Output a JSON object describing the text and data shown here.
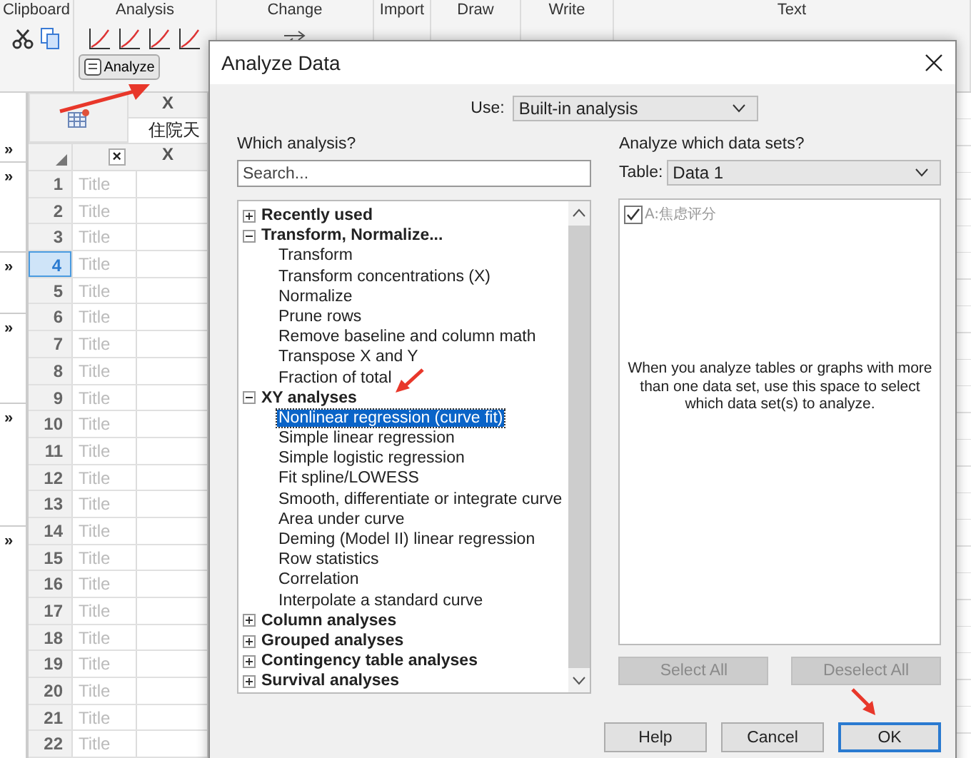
{
  "ribbon": {
    "groups": [
      {
        "label": "Clipboard"
      },
      {
        "label": "Analysis",
        "button": "Analyze"
      },
      {
        "label": "Change"
      },
      {
        "label": "Import"
      },
      {
        "label": "Draw"
      },
      {
        "label": "Write"
      },
      {
        "label": "Text"
      }
    ]
  },
  "sidebar": {
    "toggles": [
      "»",
      "»",
      "»",
      "»",
      "»",
      "»"
    ]
  },
  "sheet": {
    "header_top": "X",
    "header_sub": "住院天",
    "header_col": "X",
    "close_mark": "×",
    "rows": [
      {
        "number": "1",
        "title": "Title",
        "selected": false
      },
      {
        "number": "2",
        "title": "Title",
        "selected": false
      },
      {
        "number": "3",
        "title": "Title",
        "selected": false
      },
      {
        "number": "4",
        "title": "Title",
        "selected": true
      },
      {
        "number": "5",
        "title": "Title",
        "selected": false
      },
      {
        "number": "6",
        "title": "Title",
        "selected": false
      },
      {
        "number": "7",
        "title": "Title",
        "selected": false
      },
      {
        "number": "8",
        "title": "Title",
        "selected": false
      },
      {
        "number": "9",
        "title": "Title",
        "selected": false
      },
      {
        "number": "10",
        "title": "Title",
        "selected": false
      },
      {
        "number": "11",
        "title": "Title",
        "selected": false
      },
      {
        "number": "12",
        "title": "Title",
        "selected": false
      },
      {
        "number": "13",
        "title": "Title",
        "selected": false
      },
      {
        "number": "14",
        "title": "Title",
        "selected": false
      },
      {
        "number": "15",
        "title": "Title",
        "selected": false
      },
      {
        "number": "16",
        "title": "Title",
        "selected": false
      },
      {
        "number": "17",
        "title": "Title",
        "selected": false
      },
      {
        "number": "18",
        "title": "Title",
        "selected": false
      },
      {
        "number": "19",
        "title": "Title",
        "selected": false
      },
      {
        "number": "20",
        "title": "Title",
        "selected": false
      },
      {
        "number": "21",
        "title": "Title",
        "selected": false
      },
      {
        "number": "22",
        "title": "Title",
        "selected": false
      }
    ]
  },
  "dialog": {
    "title": "Analyze Data",
    "use_label": "Use:",
    "use_value": "Built-in analysis",
    "which_label": "Which analysis?",
    "search": {
      "placeholder": "Search..."
    },
    "tree": [
      {
        "label": "Recently used",
        "expanded": false
      },
      {
        "label": "Transform, Normalize...",
        "expanded": true,
        "children": [
          {
            "label": "Transform",
            "selected": false
          },
          {
            "label": "Transform concentrations (X)",
            "selected": false
          },
          {
            "label": "Normalize",
            "selected": false
          },
          {
            "label": "Prune rows",
            "selected": false
          },
          {
            "label": "Remove baseline and column math",
            "selected": false
          },
          {
            "label": "Transpose X and Y",
            "selected": false
          },
          {
            "label": "Fraction of total",
            "selected": false
          }
        ]
      },
      {
        "label": "XY analyses",
        "expanded": true,
        "children": [
          {
            "label": "Nonlinear regression (curve fit)",
            "selected": true
          },
          {
            "label": "Simple linear regression",
            "selected": false
          },
          {
            "label": "Simple logistic regression",
            "selected": false
          },
          {
            "label": "Fit spline/LOWESS",
            "selected": false
          },
          {
            "label": "Smooth, differentiate or integrate curve",
            "selected": false
          },
          {
            "label": "Area under curve",
            "selected": false
          },
          {
            "label": "Deming (Model II) linear regression",
            "selected": false
          },
          {
            "label": "Row statistics",
            "selected": false
          },
          {
            "label": "Correlation",
            "selected": false
          },
          {
            "label": "Interpolate a standard curve",
            "selected": false
          }
        ]
      },
      {
        "label": "Column analyses",
        "expanded": false
      },
      {
        "label": "Grouped analyses",
        "expanded": false
      },
      {
        "label": "Contingency table analyses",
        "expanded": false
      },
      {
        "label": "Survival analyses",
        "expanded": false
      }
    ],
    "datasets_label": "Analyze which data sets?",
    "table_label": "Table:",
    "table_value": "Data 1",
    "datasets": [
      {
        "label": "A:焦虑评分",
        "checked": true
      }
    ],
    "hint": "When you analyze tables or graphs with more than one data set, use this space to select which data set(s) to analyze.",
    "select_buttons": [
      {
        "label": "Select All",
        "disabled": true
      },
      {
        "label": "Deselect All",
        "disabled": true
      }
    ],
    "buttons": [
      {
        "label": "Help",
        "default": false
      },
      {
        "label": "Cancel",
        "default": false
      },
      {
        "label": "OK",
        "default": true
      }
    ]
  }
}
